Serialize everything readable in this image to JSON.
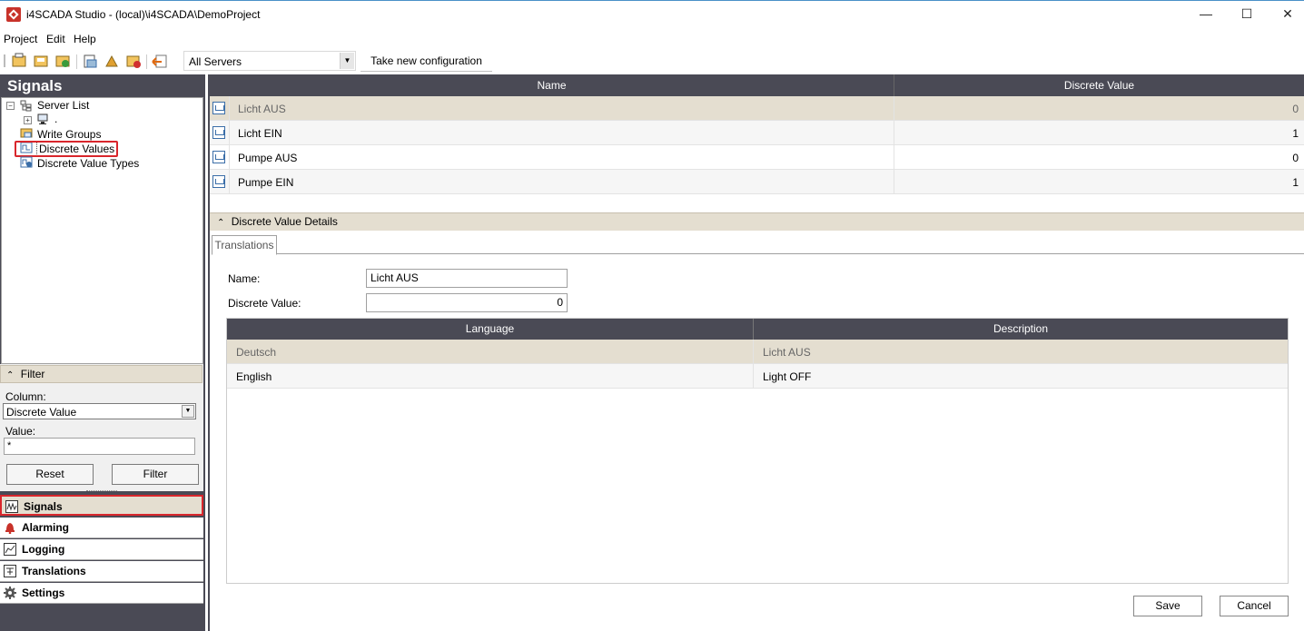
{
  "window": {
    "title": "i4SCADA Studio - (local)\\i4SCADA\\DemoProject",
    "minimize": "—",
    "maximize": "☐",
    "close": "✕"
  },
  "menu": [
    "Project",
    "Edit",
    "Help"
  ],
  "toolbar": {
    "server_select": "All Servers",
    "take_config": "Take new configuration"
  },
  "left": {
    "header": "Signals",
    "tree": {
      "server_list": "Server List",
      "server_node": ".",
      "write_groups": "Write Groups",
      "discrete_values": "Discrete Values",
      "discrete_value_types": "Discrete Value Types"
    },
    "filter": {
      "header": "Filter",
      "column_label": "Column:",
      "column_value": "Discrete Value",
      "value_label": "Value:",
      "value_value": "*",
      "reset": "Reset",
      "filter": "Filter"
    },
    "nav": [
      "Signals",
      "Alarming",
      "Logging",
      "Translations",
      "Settings"
    ]
  },
  "grid": {
    "columns": [
      "Name",
      "Discrete Value"
    ],
    "rows": [
      {
        "name": "Licht AUS",
        "value": "0",
        "selected": true
      },
      {
        "name": "Licht EIN",
        "value": "1"
      },
      {
        "name": "Pumpe AUS",
        "value": "0"
      },
      {
        "name": "Pumpe EIN",
        "value": "1"
      }
    ]
  },
  "details": {
    "header": "Discrete Value Details",
    "tab": "Translations",
    "name_label": "Name:",
    "name_value": "Licht AUS",
    "dv_label": "Discrete Value:",
    "dv_value": "0",
    "translations": {
      "columns": [
        "Language",
        "Description"
      ],
      "rows": [
        {
          "language": "Deutsch",
          "description": "Licht AUS",
          "selected": true
        },
        {
          "language": "English",
          "description": "Light OFF"
        }
      ]
    },
    "save": "Save",
    "cancel": "Cancel"
  },
  "colors": {
    "dark_header": "#4a4a55",
    "selected_row": "#e4ded0",
    "highlight_red": "#d9262c"
  }
}
